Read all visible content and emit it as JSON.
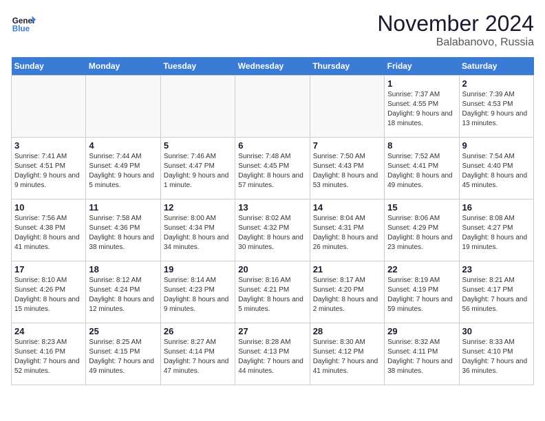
{
  "header": {
    "logo_line1": "General",
    "logo_line2": "Blue",
    "month_title": "November 2024",
    "location": "Balabanovo, Russia"
  },
  "days_of_week": [
    "Sunday",
    "Monday",
    "Tuesday",
    "Wednesday",
    "Thursday",
    "Friday",
    "Saturday"
  ],
  "weeks": [
    [
      {
        "day": "",
        "info": ""
      },
      {
        "day": "",
        "info": ""
      },
      {
        "day": "",
        "info": ""
      },
      {
        "day": "",
        "info": ""
      },
      {
        "day": "",
        "info": ""
      },
      {
        "day": "1",
        "info": "Sunrise: 7:37 AM\nSunset: 4:55 PM\nDaylight: 9 hours\nand 18 minutes."
      },
      {
        "day": "2",
        "info": "Sunrise: 7:39 AM\nSunset: 4:53 PM\nDaylight: 9 hours\nand 13 minutes."
      }
    ],
    [
      {
        "day": "3",
        "info": "Sunrise: 7:41 AM\nSunset: 4:51 PM\nDaylight: 9 hours\nand 9 minutes."
      },
      {
        "day": "4",
        "info": "Sunrise: 7:44 AM\nSunset: 4:49 PM\nDaylight: 9 hours\nand 5 minutes."
      },
      {
        "day": "5",
        "info": "Sunrise: 7:46 AM\nSunset: 4:47 PM\nDaylight: 9 hours\nand 1 minute."
      },
      {
        "day": "6",
        "info": "Sunrise: 7:48 AM\nSunset: 4:45 PM\nDaylight: 8 hours\nand 57 minutes."
      },
      {
        "day": "7",
        "info": "Sunrise: 7:50 AM\nSunset: 4:43 PM\nDaylight: 8 hours\nand 53 minutes."
      },
      {
        "day": "8",
        "info": "Sunrise: 7:52 AM\nSunset: 4:41 PM\nDaylight: 8 hours\nand 49 minutes."
      },
      {
        "day": "9",
        "info": "Sunrise: 7:54 AM\nSunset: 4:40 PM\nDaylight: 8 hours\nand 45 minutes."
      }
    ],
    [
      {
        "day": "10",
        "info": "Sunrise: 7:56 AM\nSunset: 4:38 PM\nDaylight: 8 hours\nand 41 minutes."
      },
      {
        "day": "11",
        "info": "Sunrise: 7:58 AM\nSunset: 4:36 PM\nDaylight: 8 hours\nand 38 minutes."
      },
      {
        "day": "12",
        "info": "Sunrise: 8:00 AM\nSunset: 4:34 PM\nDaylight: 8 hours\nand 34 minutes."
      },
      {
        "day": "13",
        "info": "Sunrise: 8:02 AM\nSunset: 4:32 PM\nDaylight: 8 hours\nand 30 minutes."
      },
      {
        "day": "14",
        "info": "Sunrise: 8:04 AM\nSunset: 4:31 PM\nDaylight: 8 hours\nand 26 minutes."
      },
      {
        "day": "15",
        "info": "Sunrise: 8:06 AM\nSunset: 4:29 PM\nDaylight: 8 hours\nand 23 minutes."
      },
      {
        "day": "16",
        "info": "Sunrise: 8:08 AM\nSunset: 4:27 PM\nDaylight: 8 hours\nand 19 minutes."
      }
    ],
    [
      {
        "day": "17",
        "info": "Sunrise: 8:10 AM\nSunset: 4:26 PM\nDaylight: 8 hours\nand 15 minutes."
      },
      {
        "day": "18",
        "info": "Sunrise: 8:12 AM\nSunset: 4:24 PM\nDaylight: 8 hours\nand 12 minutes."
      },
      {
        "day": "19",
        "info": "Sunrise: 8:14 AM\nSunset: 4:23 PM\nDaylight: 8 hours\nand 9 minutes."
      },
      {
        "day": "20",
        "info": "Sunrise: 8:16 AM\nSunset: 4:21 PM\nDaylight: 8 hours\nand 5 minutes."
      },
      {
        "day": "21",
        "info": "Sunrise: 8:17 AM\nSunset: 4:20 PM\nDaylight: 8 hours\nand 2 minutes."
      },
      {
        "day": "22",
        "info": "Sunrise: 8:19 AM\nSunset: 4:19 PM\nDaylight: 7 hours\nand 59 minutes."
      },
      {
        "day": "23",
        "info": "Sunrise: 8:21 AM\nSunset: 4:17 PM\nDaylight: 7 hours\nand 56 minutes."
      }
    ],
    [
      {
        "day": "24",
        "info": "Sunrise: 8:23 AM\nSunset: 4:16 PM\nDaylight: 7 hours\nand 52 minutes."
      },
      {
        "day": "25",
        "info": "Sunrise: 8:25 AM\nSunset: 4:15 PM\nDaylight: 7 hours\nand 49 minutes."
      },
      {
        "day": "26",
        "info": "Sunrise: 8:27 AM\nSunset: 4:14 PM\nDaylight: 7 hours\nand 47 minutes."
      },
      {
        "day": "27",
        "info": "Sunrise: 8:28 AM\nSunset: 4:13 PM\nDaylight: 7 hours\nand 44 minutes."
      },
      {
        "day": "28",
        "info": "Sunrise: 8:30 AM\nSunset: 4:12 PM\nDaylight: 7 hours\nand 41 minutes."
      },
      {
        "day": "29",
        "info": "Sunrise: 8:32 AM\nSunset: 4:11 PM\nDaylight: 7 hours\nand 38 minutes."
      },
      {
        "day": "30",
        "info": "Sunrise: 8:33 AM\nSunset: 4:10 PM\nDaylight: 7 hours\nand 36 minutes."
      }
    ]
  ]
}
